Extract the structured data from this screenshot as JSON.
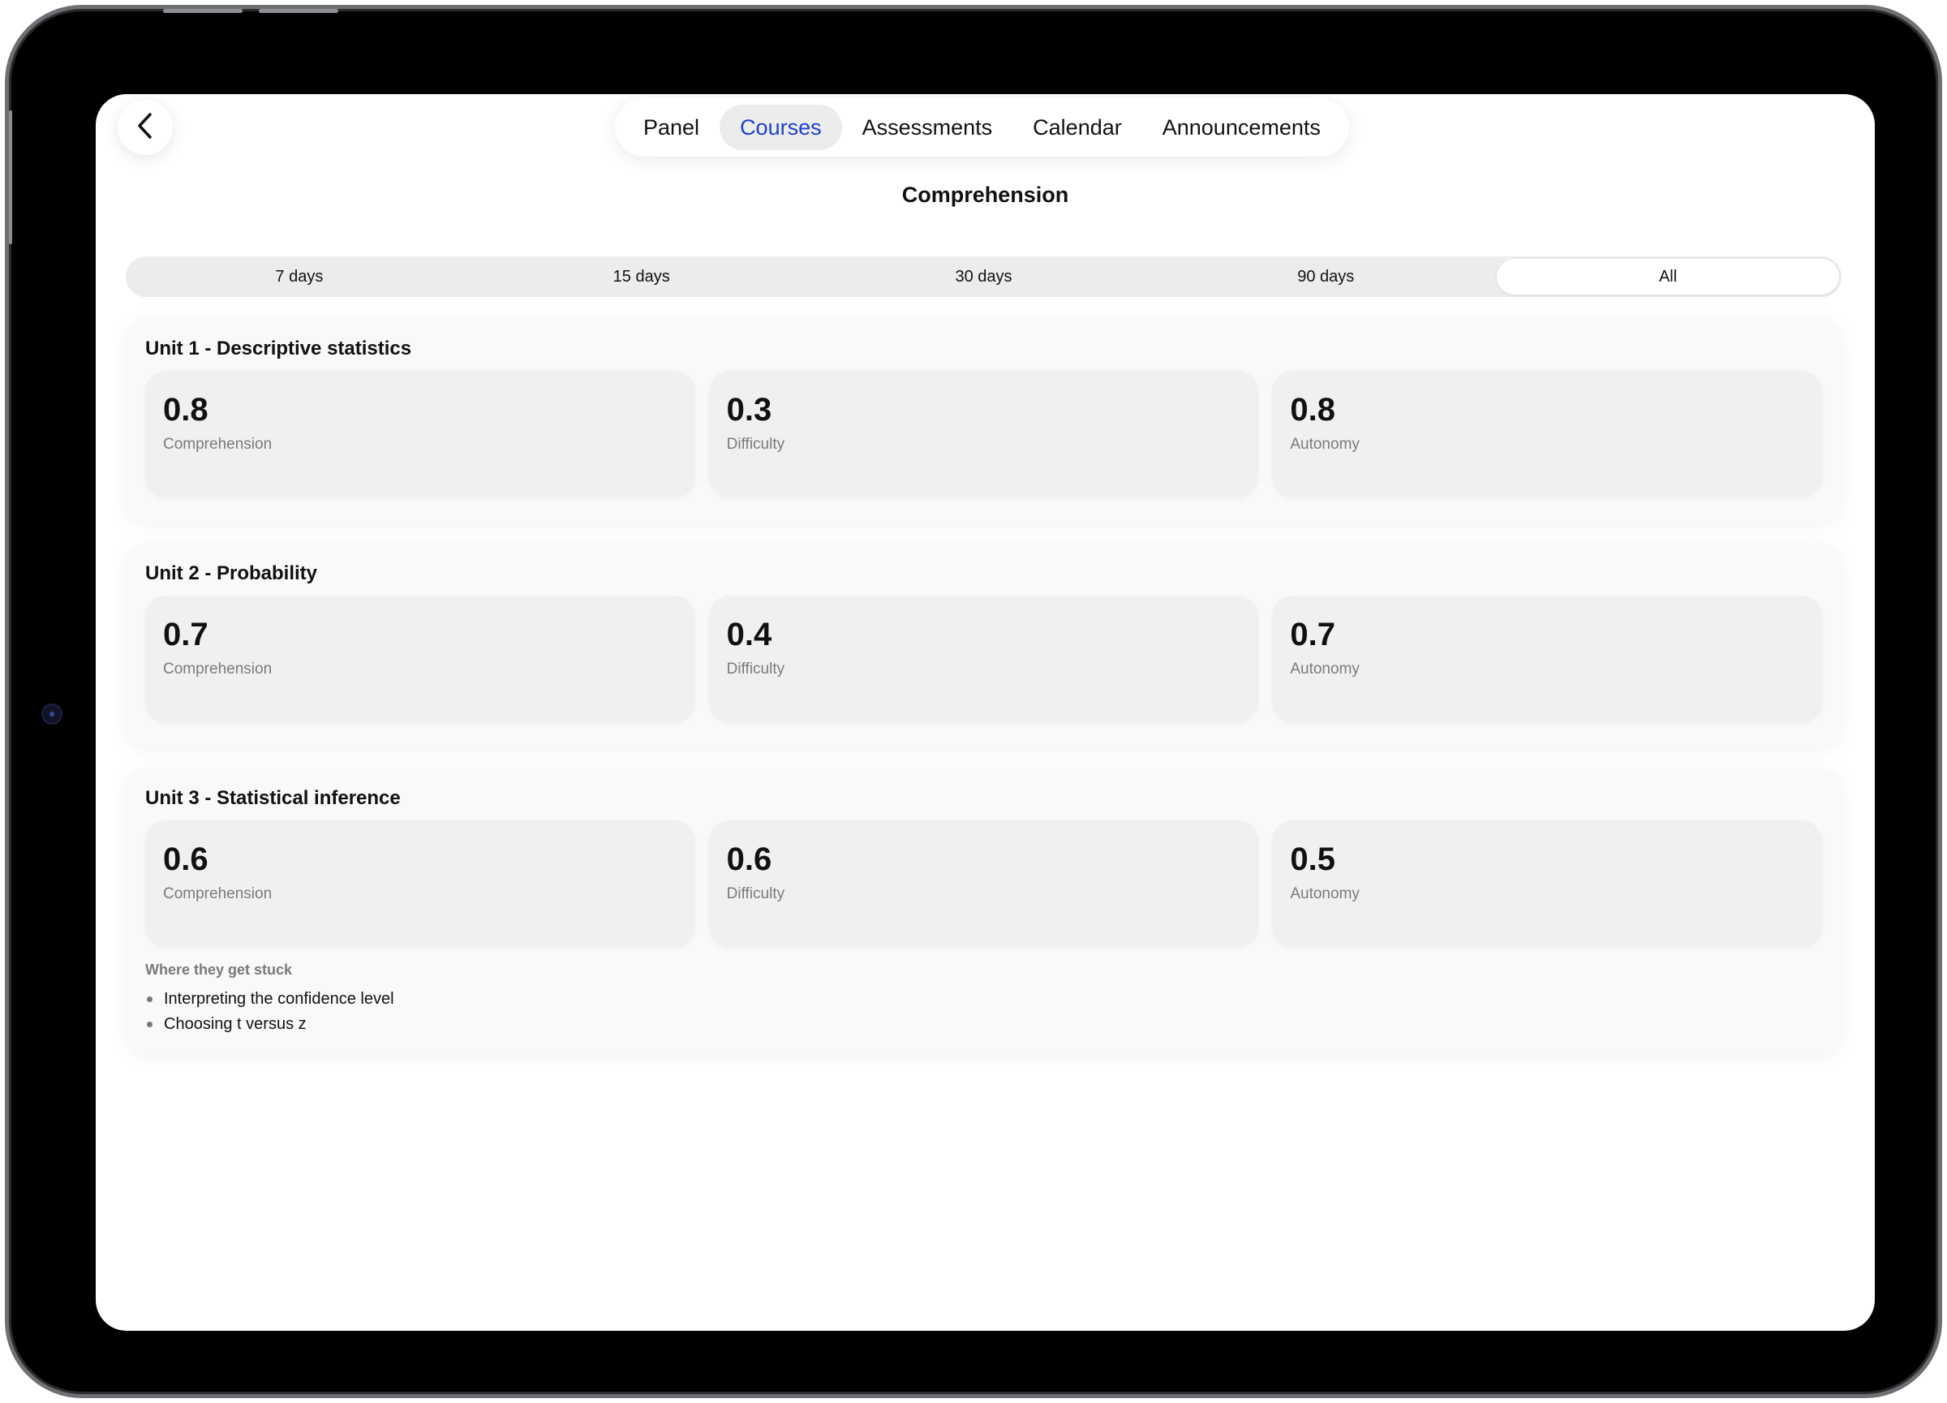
{
  "nav": {
    "tabs": [
      {
        "label": "Panel",
        "active": false
      },
      {
        "label": "Courses",
        "active": true
      },
      {
        "label": "Assessments",
        "active": false
      },
      {
        "label": "Calendar",
        "active": false
      },
      {
        "label": "Announcements",
        "active": false
      }
    ],
    "back_icon": "chevron-left-icon"
  },
  "page": {
    "title": "Comprehension"
  },
  "range": {
    "options": [
      "7 days",
      "15 days",
      "30 days",
      "90 days",
      "All"
    ],
    "selected": "All"
  },
  "units": [
    {
      "title": "Unit 1 - Descriptive statistics",
      "metrics": [
        {
          "value": "0.8",
          "label": "Comprehension"
        },
        {
          "value": "0.3",
          "label": "Difficulty"
        },
        {
          "value": "0.8",
          "label": "Autonomy"
        }
      ]
    },
    {
      "title": "Unit 2 - Probability",
      "metrics": [
        {
          "value": "0.7",
          "label": "Comprehension"
        },
        {
          "value": "0.4",
          "label": "Difficulty"
        },
        {
          "value": "0.7",
          "label": "Autonomy"
        }
      ]
    },
    {
      "title": "Unit 3 - Statistical inference",
      "metrics": [
        {
          "value": "0.6",
          "label": "Comprehension"
        },
        {
          "value": "0.6",
          "label": "Difficulty"
        },
        {
          "value": "0.5",
          "label": "Autonomy"
        }
      ],
      "stuck": {
        "title": "Where they get stuck",
        "items": [
          "Interpreting the confidence level",
          "Choosing t versus z"
        ]
      }
    }
  ],
  "colors": {
    "accent": "#1f3fd0",
    "card_bg": "#f0f0f0",
    "panel_bg": "#f9f9f8"
  }
}
